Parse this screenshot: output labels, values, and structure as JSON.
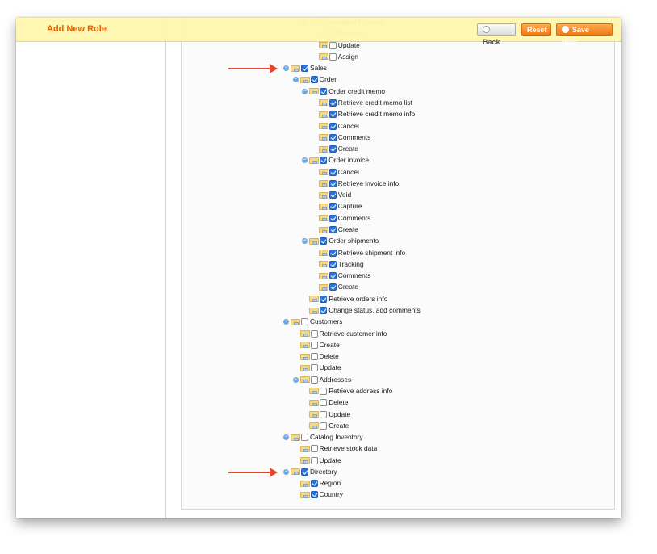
{
  "header": {
    "title": "Add New Role",
    "back_label": "Back",
    "reset_label": "Reset",
    "save_label": "Save Role"
  },
  "tree": [
    {
      "label": "Assigned Products",
      "level": 2,
      "expander": true,
      "checked": false,
      "faded": true
    },
    {
      "label": "Remove",
      "level": 3,
      "expander": false,
      "checked": false,
      "faded": true
    },
    {
      "label": "Update",
      "level": 3,
      "expander": false,
      "checked": false
    },
    {
      "label": "Assign",
      "level": 3,
      "expander": false,
      "checked": false
    },
    {
      "label": "Sales",
      "level": 0,
      "expander": true,
      "checked": true,
      "arrow": true
    },
    {
      "label": "Order",
      "level": 1,
      "expander": true,
      "checked": true
    },
    {
      "label": "Order credit memo",
      "level": 2,
      "expander": true,
      "checked": true
    },
    {
      "label": "Retrieve credit memo list",
      "level": 3,
      "expander": false,
      "checked": true
    },
    {
      "label": "Retrieve credit memo info",
      "level": 3,
      "expander": false,
      "checked": true
    },
    {
      "label": "Cancel",
      "level": 3,
      "expander": false,
      "checked": true
    },
    {
      "label": "Comments",
      "level": 3,
      "expander": false,
      "checked": true
    },
    {
      "label": "Create",
      "level": 3,
      "expander": false,
      "checked": true
    },
    {
      "label": "Order invoice",
      "level": 2,
      "expander": true,
      "checked": true
    },
    {
      "label": "Cancel",
      "level": 3,
      "expander": false,
      "checked": true
    },
    {
      "label": "Retrieve invoice info",
      "level": 3,
      "expander": false,
      "checked": true
    },
    {
      "label": "Void",
      "level": 3,
      "expander": false,
      "checked": true
    },
    {
      "label": "Capture",
      "level": 3,
      "expander": false,
      "checked": true
    },
    {
      "label": "Comments",
      "level": 3,
      "expander": false,
      "checked": true
    },
    {
      "label": "Create",
      "level": 3,
      "expander": false,
      "checked": true
    },
    {
      "label": "Order shipments",
      "level": 2,
      "expander": true,
      "checked": true
    },
    {
      "label": "Retrieve shipment info",
      "level": 3,
      "expander": false,
      "checked": true
    },
    {
      "label": "Tracking",
      "level": 3,
      "expander": false,
      "checked": true
    },
    {
      "label": "Comments",
      "level": 3,
      "expander": false,
      "checked": true
    },
    {
      "label": "Create",
      "level": 3,
      "expander": false,
      "checked": true
    },
    {
      "label": "Retrieve orders info",
      "level": 2,
      "expander": false,
      "checked": true
    },
    {
      "label": "Change status, add comments",
      "level": 2,
      "expander": false,
      "checked": true
    },
    {
      "label": "Customers",
      "level": 0,
      "expander": true,
      "checked": false
    },
    {
      "label": "Retrieve customer info",
      "level": 1,
      "expander": false,
      "checked": false
    },
    {
      "label": "Create",
      "level": 1,
      "expander": false,
      "checked": false
    },
    {
      "label": "Delete",
      "level": 1,
      "expander": false,
      "checked": false
    },
    {
      "label": "Update",
      "level": 1,
      "expander": false,
      "checked": false
    },
    {
      "label": "Addresses",
      "level": 1,
      "expander": true,
      "checked": false
    },
    {
      "label": "Retrieve address info",
      "level": 2,
      "expander": false,
      "checked": false
    },
    {
      "label": "Delete",
      "level": 2,
      "expander": false,
      "checked": false
    },
    {
      "label": "Update",
      "level": 2,
      "expander": false,
      "checked": false
    },
    {
      "label": "Create",
      "level": 2,
      "expander": false,
      "checked": false
    },
    {
      "label": "Catalog Inventory",
      "level": 0,
      "expander": true,
      "checked": false
    },
    {
      "label": "Retrieve stock data",
      "level": 1,
      "expander": false,
      "checked": false
    },
    {
      "label": "Update",
      "level": 1,
      "expander": false,
      "checked": false
    },
    {
      "label": "Directory",
      "level": 0,
      "expander": true,
      "checked": true,
      "arrow": true
    },
    {
      "label": "Region",
      "level": 1,
      "expander": false,
      "checked": true
    },
    {
      "label": "Country",
      "level": 1,
      "expander": false,
      "checked": true
    }
  ]
}
